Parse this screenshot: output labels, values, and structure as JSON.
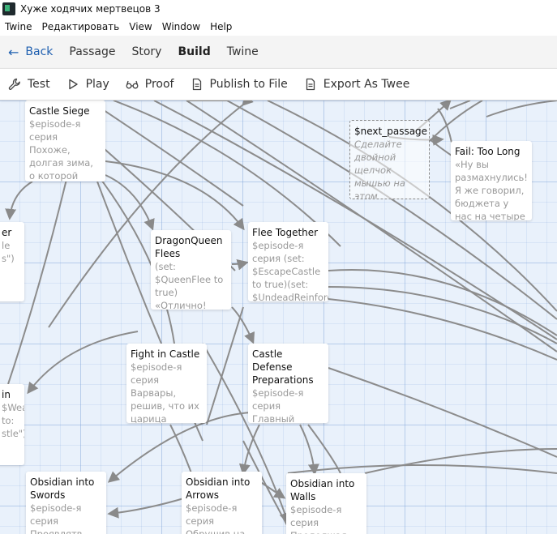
{
  "window": {
    "title": "Хуже ходячих мертвецов 3"
  },
  "menubar": {
    "items": [
      "Twine",
      "Редактировать",
      "View",
      "Window",
      "Help"
    ]
  },
  "topnav": {
    "back_label": "Back",
    "tabs": [
      "Passage",
      "Story",
      "Build",
      "Twine"
    ],
    "active_tab": "Build"
  },
  "toolbar": {
    "test_label": "Test",
    "play_label": "Play",
    "proof_label": "Proof",
    "publish_label": "Publish to File",
    "export_label": "Export As Twee"
  },
  "passages": {
    "castle_siege": {
      "title": "Castle Siege",
      "excerpt": "$episode-я серия Похоже, долгая зима, о которой говорилось в"
    },
    "next_passage": {
      "title": "$next_passage",
      "excerpt": "Сделайте двойной щелчок мышью на этом"
    },
    "fail_too_long": {
      "title": "Fail: Too Long",
      "excerpt": "«Ну вы размахнулись! Я же говорил, бюджета у нас на четыре"
    },
    "left_top": {
      "title": "er",
      "excerpt": "le s\")"
    },
    "dragonqueen_flees": {
      "title": "DragonQueen Flees",
      "excerpt": "(set: $QueenFlee to true) «Отлично! Неожиданное"
    },
    "flee_together": {
      "title": "Flee Together",
      "excerpt": "$episode-я серия (set: $EscapeCastle to true)(set: $UndeadReinforc"
    },
    "fight_in_castle": {
      "title": "Fight in Castle",
      "excerpt": "$episode-я серия Варвары, решив, что их царица разгневалась"
    },
    "castle_defense": {
      "title": "Castle Defense Preparations",
      "excerpt": "$episode-я серия Главный вопрос, встающий при"
    },
    "left_mid": {
      "title": "in",
      "excerpt": "$Weak to: stle\")"
    },
    "obsidian_swords": {
      "title": "Obsidian into Swords",
      "excerpt": "$episode-я серия Проявлятв"
    },
    "obsidian_arrows": {
      "title": "Obsidian into Arrows",
      "excerpt": "$episode-я серия Обрушив на"
    },
    "obsidian_walls": {
      "title": "Obsidian into Walls",
      "excerpt": "$episode-я серия Продолжая"
    }
  },
  "colors": {
    "accent": "#2060b0",
    "grid": "#e9f1fb",
    "arrow": "#8a8a8a"
  },
  "icons": {
    "test": "wrench-icon",
    "play": "play-icon",
    "proof": "glasses-icon",
    "publish": "file-icon",
    "export": "file-export-icon",
    "back": "arrow-left-icon"
  }
}
